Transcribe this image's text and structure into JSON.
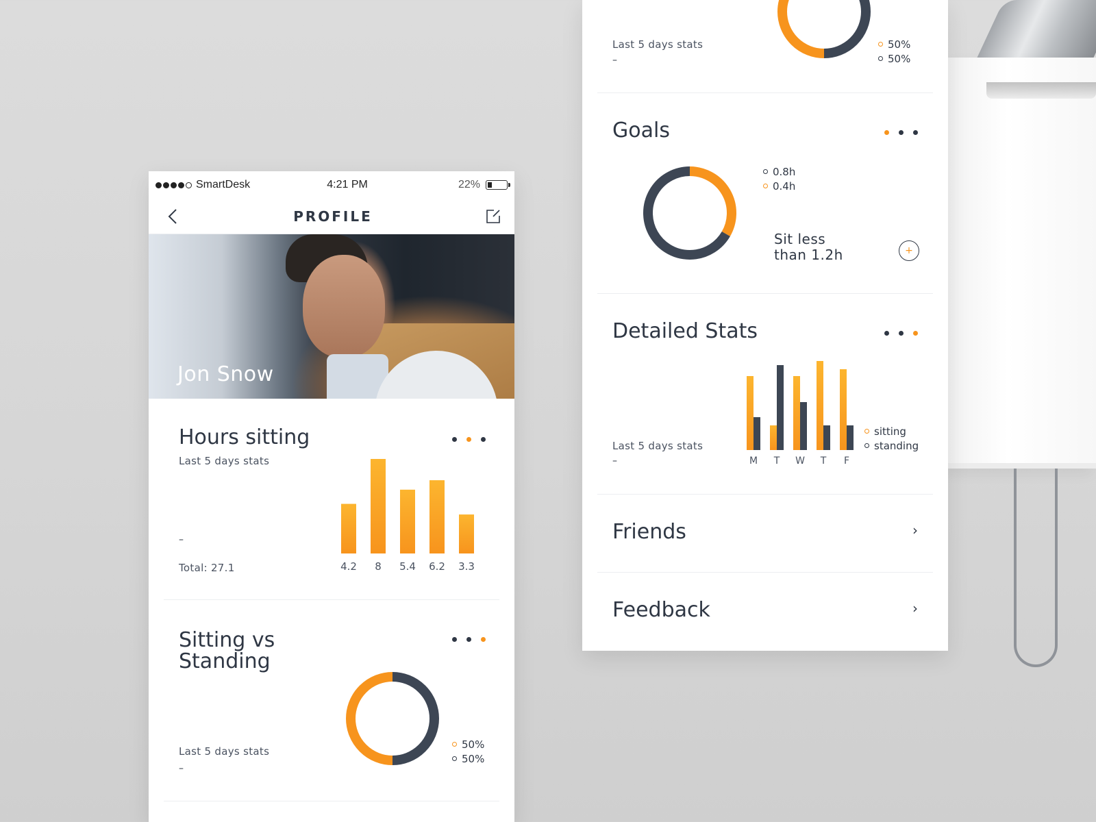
{
  "colors": {
    "accent": "#f7941d",
    "accent_light": "#fcb52f",
    "dark": "#3d4654",
    "text": "#2f3744"
  },
  "left_phone": {
    "status_bar": {
      "carrier": "SmartDesk",
      "time": "4:21 PM",
      "battery": "22%",
      "battery_level": 0.22
    },
    "nav": {
      "title": "PROFILE",
      "back_icon": "chevron-left-icon",
      "edit_icon": "edit-icon"
    },
    "profile": {
      "name": "Jon Snow"
    },
    "hours_sitting": {
      "title": "Hours sitting",
      "subtitle": "Last 5 days stats",
      "dash": "–",
      "total": "Total: 27.1",
      "labels": [
        "4.2",
        "8",
        "5.4",
        "6.2",
        "3.3"
      ]
    },
    "sitting_vs_standing": {
      "title_line1": "Sitting vs",
      "title_line2": "Standing",
      "subtitle": "Last 5 days stats",
      "dash": "–",
      "legend": [
        "50%",
        "50%"
      ]
    }
  },
  "right_panel": {
    "top_stats": {
      "subtitle": "Last 5 days stats",
      "dash": "–",
      "legend": [
        "50%",
        "50%"
      ]
    },
    "goals": {
      "title": "Goals",
      "legend": [
        "0.8h",
        "0.4h"
      ],
      "goal_line1": "Sit less",
      "goal_line2": "than 1.2h",
      "plus_label": "+"
    },
    "detailed_stats": {
      "title": "Detailed Stats",
      "subtitle": "Last 5 days stats",
      "dash": "–",
      "days": [
        "M",
        "T",
        "W",
        "T",
        "F"
      ],
      "legend": [
        "sitting",
        "standing"
      ]
    },
    "friends": {
      "label": "Friends",
      "chevron": "›"
    },
    "feedback": {
      "label": "Feedback",
      "chevron": "›"
    }
  },
  "chart_data": [
    {
      "type": "bar",
      "categories": [
        "4.2",
        "8",
        "5.4",
        "6.2",
        "3.3"
      ],
      "values": [
        4.2,
        8,
        5.4,
        6.2,
        3.3
      ],
      "title": "Hours sitting"
    },
    {
      "type": "pie",
      "title": "Sitting vs Standing",
      "slices": [
        {
          "label": "50%",
          "value": 50
        },
        {
          "label": "50%",
          "value": 50
        }
      ]
    },
    {
      "type": "pie",
      "slices": [
        {
          "label": "50%",
          "value": 50
        },
        {
          "label": "50%",
          "value": 50
        }
      ]
    },
    {
      "type": "pie",
      "title": "Goals",
      "slices": [
        {
          "label": "0.4h",
          "value": 0.4
        },
        {
          "label": "0.8h",
          "value": 0.8
        }
      ]
    },
    {
      "type": "bar",
      "title": "Detailed Stats",
      "categories": [
        "M",
        "T",
        "W",
        "T",
        "F"
      ],
      "series": [
        {
          "name": "sitting",
          "values": [
            5.4,
            1.8,
            5.4,
            6.5,
            5.9
          ]
        },
        {
          "name": "standing",
          "values": [
            2.4,
            6.2,
            3.5,
            1.8,
            1.8
          ]
        }
      ]
    }
  ]
}
